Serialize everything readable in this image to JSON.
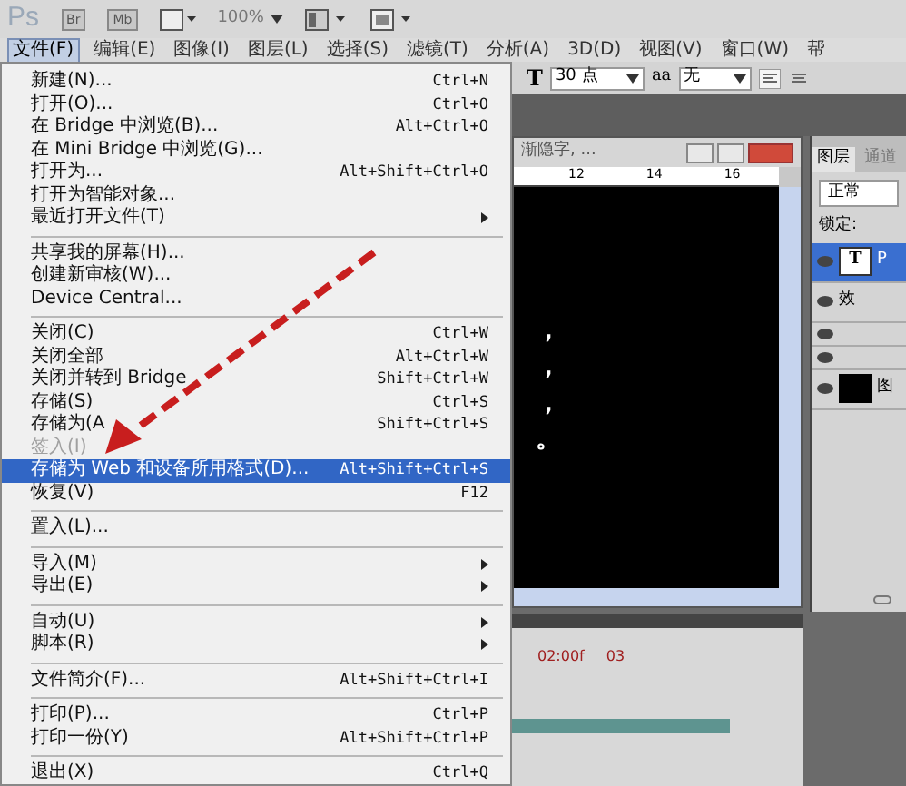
{
  "app_bar": {
    "logo": "Ps",
    "buttons": [
      "Br",
      "Mb"
    ],
    "zoom": "100%"
  },
  "menu_bar": [
    {
      "label": "文件(F)",
      "selected": true
    },
    {
      "label": "编辑(E)",
      "selected": false
    },
    {
      "label": "图像(I)",
      "selected": false
    },
    {
      "label": "图层(L)",
      "selected": false
    },
    {
      "label": "选择(S)",
      "selected": false
    },
    {
      "label": "滤镜(T)",
      "selected": false
    },
    {
      "label": "分析(A)",
      "selected": false
    },
    {
      "label": "3D(D)",
      "selected": false
    },
    {
      "label": "视图(V)",
      "selected": false
    },
    {
      "label": "窗口(W)",
      "selected": false
    },
    {
      "label": "帮",
      "selected": false
    }
  ],
  "file_menu": [
    {
      "kind": "item",
      "label": "新建(N)...",
      "shortcut": "Ctrl+N",
      "submenu": false,
      "disabled": false,
      "selected": false
    },
    {
      "kind": "item",
      "label": "打开(O)...",
      "shortcut": "Ctrl+O",
      "submenu": false,
      "disabled": false,
      "selected": false
    },
    {
      "kind": "item",
      "label": "在 Bridge 中浏览(B)...",
      "shortcut": "Alt+Ctrl+O",
      "submenu": false,
      "disabled": false,
      "selected": false
    },
    {
      "kind": "item",
      "label": "在 Mini Bridge 中浏览(G)...",
      "submenu": false,
      "disabled": false,
      "selected": false
    },
    {
      "kind": "item",
      "label": "打开为...",
      "shortcut": "Alt+Shift+Ctrl+O",
      "submenu": false,
      "disabled": false,
      "selected": false
    },
    {
      "kind": "item",
      "label": "打开为智能对象...",
      "submenu": false,
      "disabled": false,
      "selected": false
    },
    {
      "kind": "item",
      "label": "最近打开文件(T)",
      "submenu": true,
      "disabled": false,
      "selected": false
    },
    {
      "kind": "separator"
    },
    {
      "kind": "item",
      "label": "共享我的屏幕(H)...",
      "submenu": false,
      "disabled": false,
      "selected": false
    },
    {
      "kind": "item",
      "label": "创建新审核(W)...",
      "submenu": false,
      "disabled": false,
      "selected": false
    },
    {
      "kind": "item",
      "label": "Device Central...",
      "submenu": false,
      "disabled": false,
      "selected": false
    },
    {
      "kind": "separator"
    },
    {
      "kind": "item",
      "label": "关闭(C)",
      "shortcut": "Ctrl+W",
      "submenu": false,
      "disabled": false,
      "selected": false
    },
    {
      "kind": "item",
      "label": "关闭全部",
      "shortcut": "Alt+Ctrl+W",
      "submenu": false,
      "disabled": false,
      "selected": false
    },
    {
      "kind": "item",
      "label": "关闭并转到 Bridge",
      "shortcut": "Shift+Ctrl+W",
      "submenu": false,
      "disabled": false,
      "selected": false
    },
    {
      "kind": "item",
      "label": "存储(S)",
      "shortcut": "Ctrl+S",
      "submenu": false,
      "disabled": false,
      "selected": false
    },
    {
      "kind": "item",
      "label": "存储为(A",
      "shortcut": "Shift+Ctrl+S",
      "submenu": false,
      "disabled": false,
      "selected": false
    },
    {
      "kind": "item",
      "label": "签入(I)",
      "submenu": false,
      "disabled": true,
      "selected": false
    },
    {
      "kind": "item",
      "label": "存储为 Web 和设备所用格式(D)...",
      "shortcut": "Alt+Shift+Ctrl+S",
      "submenu": false,
      "disabled": false,
      "selected": true
    },
    {
      "kind": "item",
      "label": "恢复(V)",
      "shortcut": "F12",
      "submenu": false,
      "disabled": false,
      "selected": false
    },
    {
      "kind": "separator"
    },
    {
      "kind": "item",
      "label": "置入(L)...",
      "submenu": false,
      "disabled": false,
      "selected": false
    },
    {
      "kind": "separator"
    },
    {
      "kind": "item",
      "label": "导入(M)",
      "submenu": true,
      "disabled": false,
      "selected": false
    },
    {
      "kind": "item",
      "label": "导出(E)",
      "submenu": true,
      "disabled": false,
      "selected": false
    },
    {
      "kind": "separator"
    },
    {
      "kind": "item",
      "label": "自动(U)",
      "submenu": true,
      "disabled": false,
      "selected": false
    },
    {
      "kind": "item",
      "label": "脚本(R)",
      "submenu": true,
      "disabled": false,
      "selected": false
    },
    {
      "kind": "separator"
    },
    {
      "kind": "item",
      "label": "文件简介(F)...",
      "shortcut": "Alt+Shift+Ctrl+I",
      "submenu": false,
      "disabled": false,
      "selected": false
    },
    {
      "kind": "separator"
    },
    {
      "kind": "item",
      "label": "打印(P)...",
      "shortcut": "Ctrl+P",
      "submenu": false,
      "disabled": false,
      "selected": false
    },
    {
      "kind": "item",
      "label": "打印一份(Y)",
      "shortcut": "Alt+Shift+Ctrl+P",
      "submenu": false,
      "disabled": false,
      "selected": false
    },
    {
      "kind": "separator"
    },
    {
      "kind": "item",
      "label": "退出(X)",
      "shortcut": "Ctrl+Q",
      "submenu": false,
      "disabled": false,
      "selected": false
    }
  ],
  "options_bar": {
    "tool_icon": "T",
    "font_size": "30 点",
    "antialias_icon": "aa",
    "antialias": "无"
  },
  "document": {
    "title": "渐隐字, ...",
    "ruler": [
      "12",
      "14",
      "16"
    ],
    "canvas_lines": [
      "，",
      "，",
      "，",
      "。"
    ]
  },
  "layers_panel": {
    "tabs": [
      {
        "label": "图层",
        "selected": true
      },
      {
        "label": "通道",
        "selected": false
      }
    ],
    "blend_mode": "正常",
    "lock_label": "锁定:",
    "layers": [
      {
        "kind": "text",
        "thumb": "T",
        "name": "P",
        "selected": true
      },
      {
        "kind": "effects",
        "name": "效",
        "selected": false
      },
      {
        "kind": "effect",
        "selected": false
      },
      {
        "kind": "effect",
        "selected": false
      },
      {
        "kind": "image",
        "name": "图",
        "selected": false
      }
    ]
  },
  "timeline": {
    "ticks": [
      "02:00f",
      "03"
    ]
  }
}
